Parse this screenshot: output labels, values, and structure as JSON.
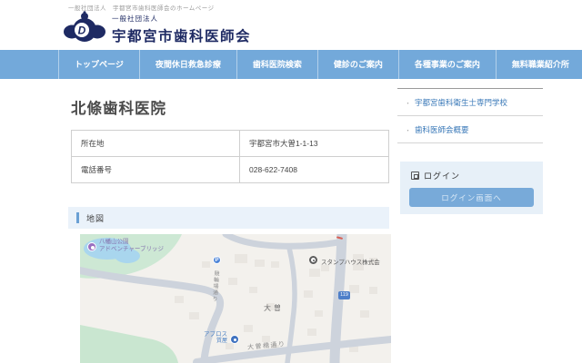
{
  "meta": {
    "tagline": "一般社団法人　宇都宮市歯科医師会のホームページ"
  },
  "header": {
    "org_type": "一般社団法人",
    "org_name": "宇都宮市歯科医師会",
    "logo_letter": "D"
  },
  "nav": {
    "items": [
      {
        "label": "トップページ"
      },
      {
        "label": "夜間休日救急診療"
      },
      {
        "label": "歯科医院検索"
      },
      {
        "label": "健診のご案内"
      },
      {
        "label": "各種事業のご案内"
      },
      {
        "label": "無料職業紹介所"
      }
    ]
  },
  "main": {
    "clinic_name": "北條歯科医院",
    "info_table": {
      "rows": [
        {
          "label": "所在地",
          "value": "宇都宮市大曽1-1-13"
        },
        {
          "label": "電話番号",
          "value": "028-622-7408"
        }
      ]
    },
    "map_section_title": "地図"
  },
  "sidebar": {
    "links": [
      {
        "bullet": "・",
        "label": "宇都宮歯科衛生士専門学校"
      },
      {
        "bullet": "・",
        "label": "歯科医師会概要"
      }
    ],
    "login": {
      "title": "ログイン",
      "button": "ログイン画面へ"
    }
  },
  "map": {
    "labels": {
      "park_poi_line1": "八幡山公園",
      "park_poi_line2": "アドベンチャーブリッジ",
      "parking": "P",
      "company": "スタンプハウス株式会",
      "district": "大曽",
      "shop_line1": "アプロス",
      "shop_line2": "質屋",
      "street_bottom": "大曽橋通り",
      "street_vertical": "競輪場通り",
      "route_shield": "119"
    }
  },
  "colors": {
    "nav_blue": "#73a9da",
    "brand_navy": "#1e2a63",
    "link_blue": "#3a79b8",
    "section_bg": "#eaf2fa",
    "login_panel_bg": "#e7f0f8",
    "login_button_bg": "#78aad9",
    "map_road": "#cdd3dc",
    "map_green": "#cde8d4",
    "map_water": "#a9d6ee"
  }
}
